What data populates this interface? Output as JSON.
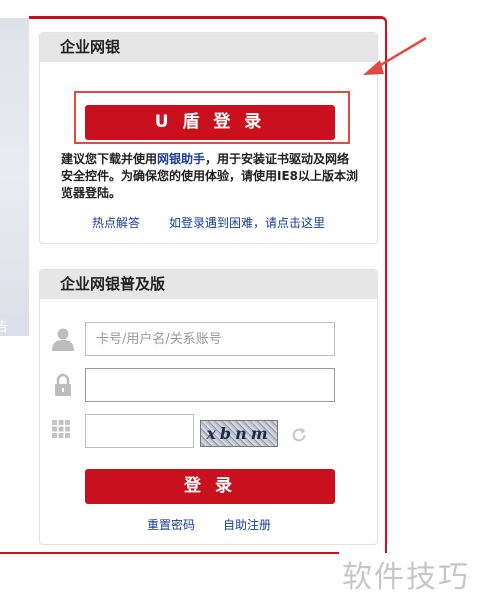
{
  "banner": {
    "fragment_text": "告"
  },
  "ushield_box": {
    "title": "企业网银",
    "button_label": "U 盾 登 录",
    "notice_part1": "建议您下载并使用",
    "notice_link": "网银助手",
    "notice_part2": "，用于安装证书驱动及网络安全控件。为确保您的使用体验，请使用IE8以上版本浏览器登陆。",
    "link_faq": "热点解答",
    "link_help": "如登录遇到困难，请点击这里"
  },
  "normal_box": {
    "title": "企业网银普及版",
    "account_placeholder": "卡号/用户名/关系账号",
    "password_value": "",
    "captcha_value": "",
    "captcha_text": "xbnm",
    "login_label": "登 录",
    "link_reset": "重置密码",
    "link_register": "自助注册"
  },
  "watermark": "软件技巧",
  "colors": {
    "brand_red": "#c8101e",
    "highlight_red": "#e2493f",
    "link_blue": "#1a3d9e"
  },
  "icons": [
    "user-icon",
    "lock-icon",
    "keypad-icon",
    "refresh-icon",
    "arrow-pointer-icon"
  ]
}
